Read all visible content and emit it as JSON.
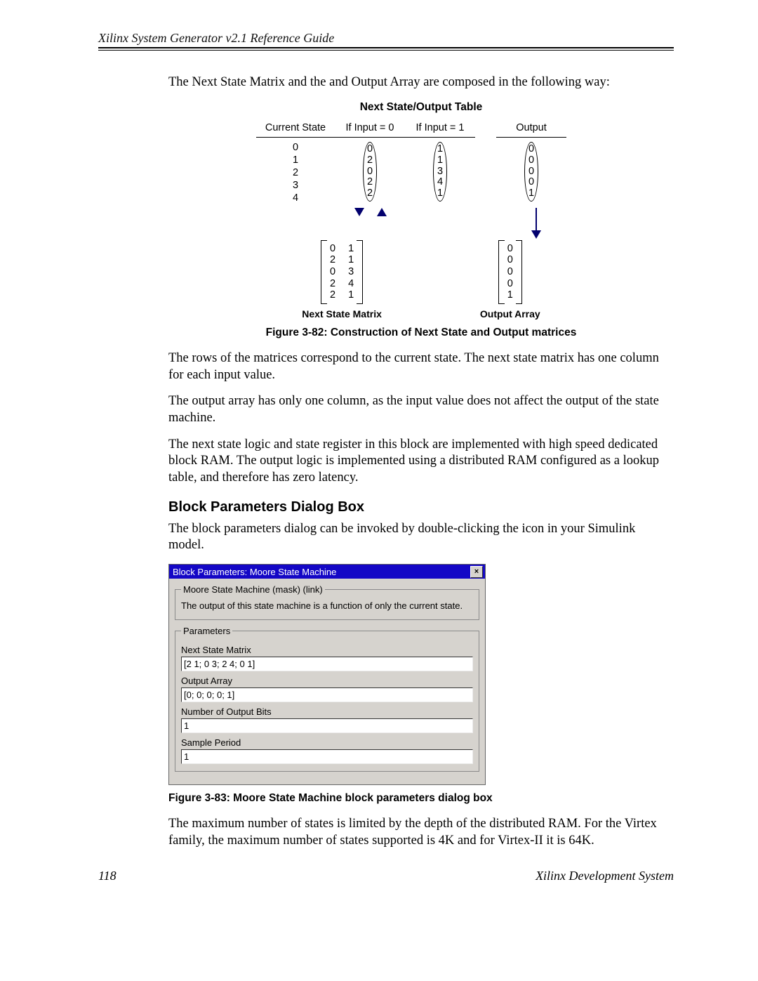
{
  "header": {
    "title": "Xilinx System Generator v2.1 Reference Guide"
  },
  "intro": "The Next State Matrix and the and Output Array are composed in the following way:",
  "fig82": {
    "diagram_title": "Next State/Output Table",
    "columns": {
      "current_state": "Current State",
      "input0": "If Input = 0",
      "input1": "If Input = 1",
      "output": "Output"
    },
    "table": {
      "current_state": [
        "0",
        "1",
        "2",
        "3",
        "4"
      ],
      "input0": [
        "0",
        "2",
        "0",
        "2",
        "2"
      ],
      "input1": [
        "1",
        "1",
        "3",
        "4",
        "1"
      ],
      "output": [
        "0",
        "0",
        "0",
        "0",
        "1"
      ]
    },
    "matrix_next_state": {
      "col0": [
        "0",
        "2",
        "0",
        "2",
        "2"
      ],
      "col1": [
        "1",
        "1",
        "3",
        "4",
        "1"
      ]
    },
    "matrix_output": {
      "col": [
        "0",
        "0",
        "0",
        "0",
        "1"
      ]
    },
    "label_next_state_matrix": "Next State Matrix",
    "label_output_array": "Output Array",
    "caption": "Figure 3-82:   Construction of Next State and Output matrices"
  },
  "para_rows": "The rows of the matrices correspond to the current state.  The next state matrix has one column for each input value.",
  "para_output_array": "The output array has only one column, as the input value does not affect the output of the state machine.",
  "para_impl": "The next state logic and state register in this block are implemented with high speed dedicated block RAM.  The output logic is implemented using a distributed RAM configured as a lookup table, and therefore has zero latency.",
  "section_title": "Block Parameters Dialog Box",
  "para_invoke": "The block parameters dialog can be invoked by double-clicking the icon in your Simulink model.",
  "dialog": {
    "title": "Block Parameters: Moore State Machine",
    "group_title": "Moore State Machine (mask) (link)",
    "description": "The output of this state machine is a function of only the current state.",
    "params_title": "Parameters",
    "fields": {
      "next_state_matrix": {
        "label": "Next State Matrix",
        "value": "[2 1; 0 3; 2 4; 0 1]"
      },
      "output_array": {
        "label": "Output Array",
        "value": "[0; 0; 0; 0; 1]"
      },
      "num_output_bits": {
        "label": "Number of Output Bits",
        "value": "1"
      },
      "sample_period": {
        "label": "Sample Period",
        "value": "1"
      }
    }
  },
  "fig83_caption": "Figure 3-83:   Moore State Machine block parameters dialog box",
  "para_max_states": "The maximum number of states is limited by the depth of the distributed RAM.  For the Virtex family, the maximum number of states supported is 4K and for Virtex-II it is 64K.",
  "footer": {
    "page_number": "118",
    "right": "Xilinx Development System"
  }
}
